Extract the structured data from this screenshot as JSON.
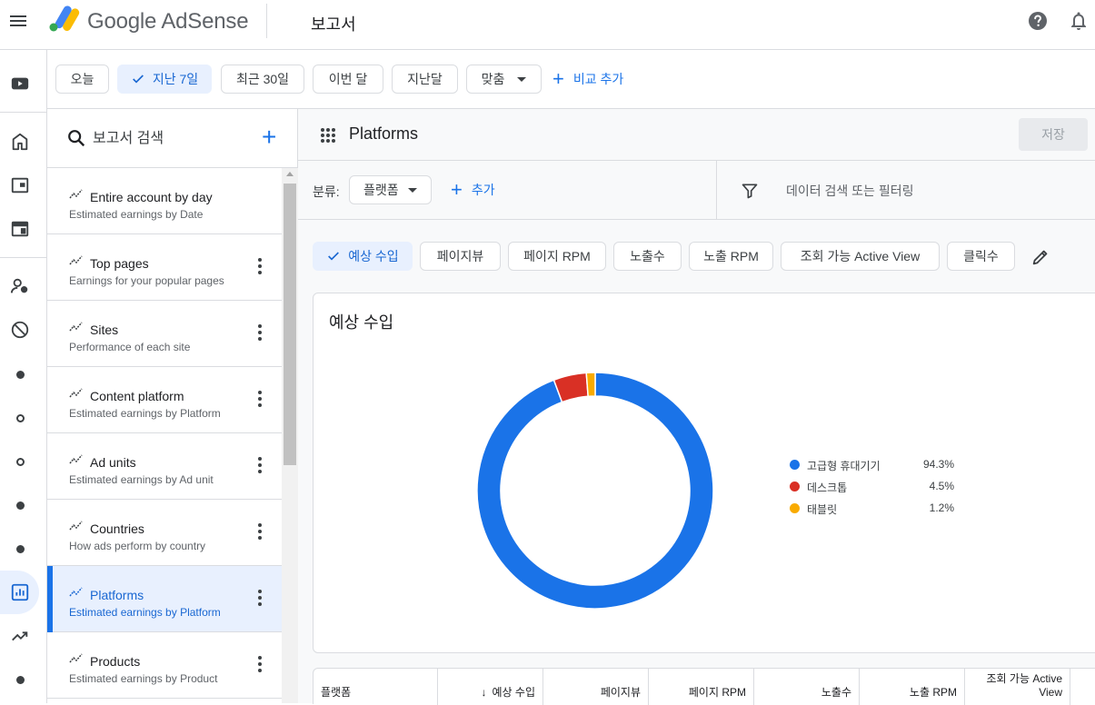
{
  "app": {
    "logo_text": "Google AdSense",
    "page_title": "보고서"
  },
  "date_range": {
    "options": [
      {
        "label": "오늘",
        "selected": false
      },
      {
        "label": "지난 7일",
        "selected": true
      },
      {
        "label": "최근 30일",
        "selected": false
      },
      {
        "label": "이번 달",
        "selected": false
      },
      {
        "label": "지난달",
        "selected": false
      },
      {
        "label": "맞춤",
        "selected": false
      }
    ],
    "add_compare": "비교 추가"
  },
  "report_list": {
    "search_placeholder": "보고서 검색",
    "items": [
      {
        "title": "Entire account by day",
        "subtitle": "Estimated earnings by Date",
        "active": false
      },
      {
        "title": "Top pages",
        "subtitle": "Earnings for your popular pages",
        "active": false
      },
      {
        "title": "Sites",
        "subtitle": "Performance of each site",
        "active": false
      },
      {
        "title": "Content platform",
        "subtitle": "Estimated earnings by Platform",
        "active": false
      },
      {
        "title": "Ad units",
        "subtitle": "Estimated earnings by Ad unit",
        "active": false
      },
      {
        "title": "Countries",
        "subtitle": "How ads perform by country",
        "active": false
      },
      {
        "title": "Platforms",
        "subtitle": "Estimated earnings by Platform",
        "active": true
      },
      {
        "title": "Products",
        "subtitle": "Estimated earnings by Product",
        "active": false
      }
    ]
  },
  "report": {
    "title": "Platforms",
    "save_label": "저장",
    "breakdown_label": "분류:",
    "breakdown_value": "플랫폼",
    "add_label": "추가",
    "filter_placeholder": "데이터 검색 또는 필터링",
    "metrics": [
      {
        "label": "예상 수입",
        "selected": true
      },
      {
        "label": "페이지뷰",
        "selected": false
      },
      {
        "label": "페이지 RPM",
        "selected": false
      },
      {
        "label": "노출수",
        "selected": false
      },
      {
        "label": "노출 RPM",
        "selected": false
      },
      {
        "label": "조회 가능 Active View",
        "selected": false
      },
      {
        "label": "클릭수",
        "selected": false
      }
    ],
    "chart_title": "예상 수입",
    "table_headers": [
      "플랫폼",
      "예상 수입",
      "페이지뷰",
      "페이지 RPM",
      "노출수",
      "노출 RPM",
      "조회 가능 Active View"
    ]
  },
  "chart_data": {
    "type": "pie",
    "title": "예상 수입",
    "categories": [
      "고급형 휴대기기",
      "데스크톱",
      "태블릿"
    ],
    "values": [
      94.3,
      4.5,
      1.2
    ],
    "labels": [
      "94.3%",
      "4.5%",
      "1.2%"
    ],
    "colors": [
      "#1a73e8",
      "#d93025",
      "#f9ab00"
    ],
    "legend_position": "right"
  }
}
